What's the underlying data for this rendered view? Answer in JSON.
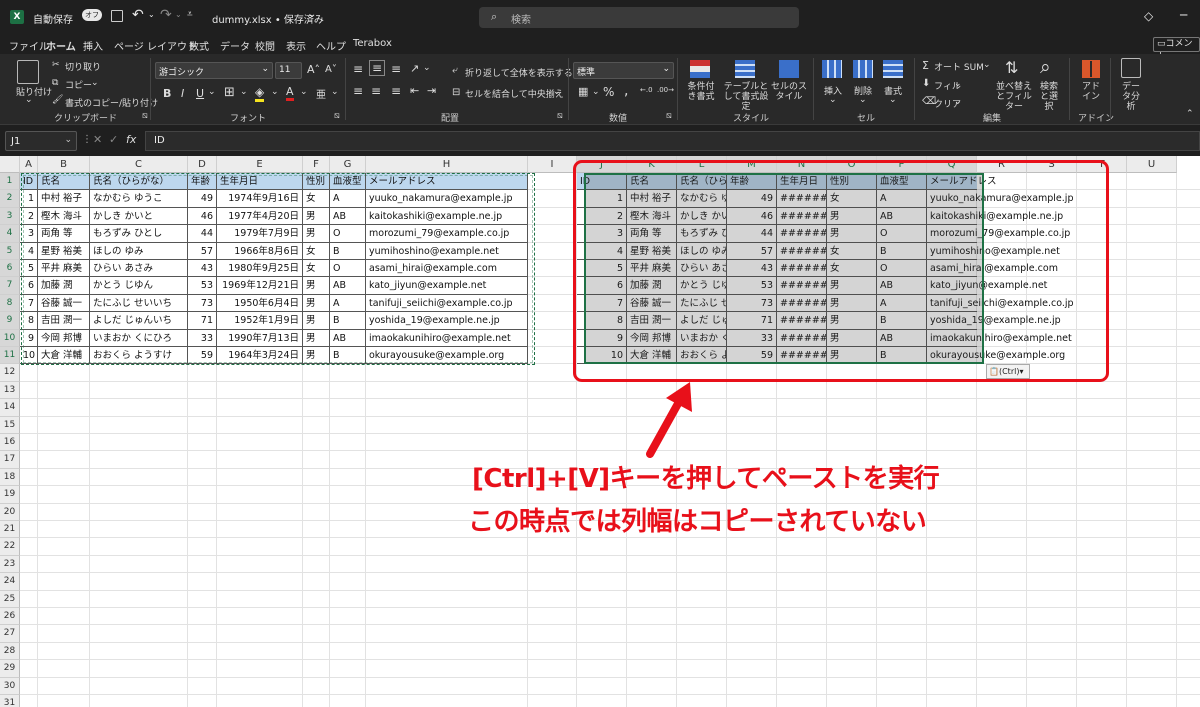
{
  "titlebar": {
    "autosave_label": "自動保存",
    "autosave_state": "オフ",
    "filename": "dummy.xlsx • 保存済み",
    "search_placeholder": "検索"
  },
  "menu": [
    "ファイル",
    "ホーム",
    "挿入",
    "ページ レイアウト",
    "数式",
    "データ",
    "校閲",
    "表示",
    "ヘルプ",
    "Terabox"
  ],
  "comment_button": "コメント",
  "ribbon": {
    "clipboard": {
      "paste": "貼り付け",
      "cut": "切り取り",
      "copy": "コピー",
      "format_painter": "書式のコピー/貼り付け",
      "group": "クリップボード"
    },
    "font": {
      "name": "游ゴシック",
      "size": "11",
      "group": "フォント"
    },
    "alignment": {
      "wrap": "折り返して全体を表示する",
      "merge": "セルを結合して中央揃え",
      "group": "配置"
    },
    "number": {
      "format": "標準",
      "group": "数値"
    },
    "styles": {
      "conditional": "条件付き書式",
      "table": "テーブルとして書式設定",
      "cell": "セルのスタイル",
      "group": "スタイル"
    },
    "cells": {
      "insert": "挿入",
      "delete": "削除",
      "format": "書式",
      "group": "セル"
    },
    "editing": {
      "autosum": "オート SUM",
      "fill": "フィル",
      "clear": "クリア",
      "sort": "並べ替えとフィルター",
      "find": "検索と選択",
      "group": "編集"
    },
    "addins": {
      "addin": "アドイン",
      "group": "アドイン"
    },
    "analysis": {
      "data": "データ分析"
    }
  },
  "formula_bar": {
    "name_box": "J1",
    "fx": "fx",
    "content": "ID"
  },
  "columns": [
    "A",
    "B",
    "C",
    "D",
    "E",
    "F",
    "G",
    "H",
    "I",
    "J",
    "K",
    "L",
    "M",
    "N",
    "O",
    "P",
    "Q",
    "R",
    "S",
    "T",
    "U"
  ],
  "rows": [
    "1",
    "2",
    "3",
    "4",
    "5",
    "6",
    "7",
    "8",
    "9",
    "10",
    "11",
    "12",
    "13",
    "14",
    "15",
    "16",
    "17",
    "18",
    "19",
    "20",
    "21",
    "22",
    "23",
    "24",
    "25",
    "26",
    "27",
    "28",
    "29",
    "30",
    "31"
  ],
  "table": {
    "headers": [
      "ID",
      "氏名",
      "氏名（ひらがな）",
      "年齢",
      "生年月日",
      "性別",
      "血液型",
      "メールアドレス"
    ],
    "rows": [
      [
        "1",
        "中村 裕子",
        "なかむら ゆうこ",
        "49",
        "1974年9月16日",
        "女",
        "A",
        "yuuko_nakamura@example.jp"
      ],
      [
        "2",
        "樫木 海斗",
        "かしき かいと",
        "46",
        "1977年4月20日",
        "男",
        "AB",
        "kaitokashiki@example.ne.jp"
      ],
      [
        "3",
        "両角 等",
        "もろずみ ひとし",
        "44",
        "1979年7月9日",
        "男",
        "O",
        "morozumi_79@example.co.jp"
      ],
      [
        "4",
        "星野 裕美",
        "ほしの ゆみ",
        "57",
        "1966年8月6日",
        "女",
        "B",
        "yumihoshino@example.net"
      ],
      [
        "5",
        "平井 麻美",
        "ひらい あさみ",
        "43",
        "1980年9月25日",
        "女",
        "O",
        "asami_hirai@example.com"
      ],
      [
        "6",
        "加藤 潤",
        "かとう じゆん",
        "53",
        "1969年12月21日",
        "男",
        "AB",
        "kato_jiyun@example.net"
      ],
      [
        "7",
        "谷藤 誠一",
        "たにふじ せいいち",
        "73",
        "1950年6月4日",
        "男",
        "A",
        "tanifuji_seiichi@example.co.jp"
      ],
      [
        "8",
        "吉田 潤一",
        "よしだ じゅんいち",
        "71",
        "1952年1月9日",
        "男",
        "B",
        "yoshida_19@example.ne.jp"
      ],
      [
        "9",
        "今岡 邦博",
        "いまおか くにひろ",
        "33",
        "1990年7月13日",
        "男",
        "AB",
        "imaokakunihiro@example.net"
      ],
      [
        "10",
        "大倉 洋輔",
        "おおくら ようすけ",
        "59",
        "1964年3月24日",
        "男",
        "B",
        "okurayousuke@example.org"
      ]
    ]
  },
  "paste_hashes": "#######",
  "paste_options": "(Ctrl)",
  "annotation": {
    "line1": "[Ctrl]+[V]キーを押してペーストを実行",
    "line2": "この時点では列幅はコピーされていない",
    "color": "#e8101a"
  }
}
